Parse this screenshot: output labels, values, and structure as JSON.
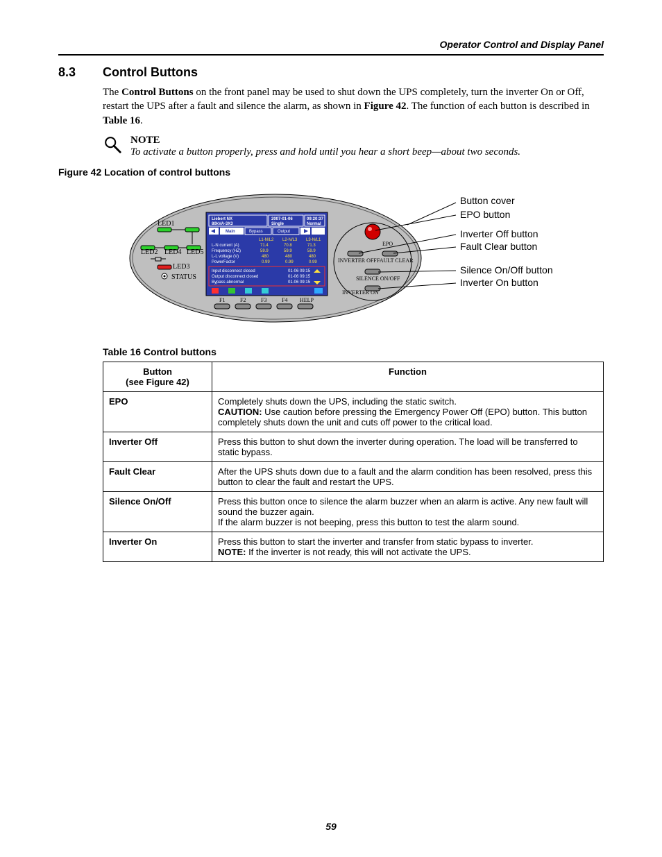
{
  "header": {
    "running": "Operator Control and Display Panel"
  },
  "section": {
    "number": "8.3",
    "title": "Control Buttons"
  },
  "para": {
    "p1a": "The ",
    "p1b": "Control Buttons",
    "p1c": " on the front panel may be used to shut down the UPS completely, turn the inverter On or Off, restart the UPS after a fault and silence the alarm, as shown in ",
    "p1d": "Figure 42",
    "p1e": ". The function of each button is described in ",
    "p1f": "Table 16",
    "p1g": "."
  },
  "note": {
    "title": "NOTE",
    "text": "To activate a button properly, press and hold until you hear a short beep—about two seconds."
  },
  "figure": {
    "caption": "Figure 42  Location of control buttons",
    "callouts": {
      "cover": "Button cover",
      "epo": "EPO button",
      "invoff": "Inverter Off button",
      "fault": "Fault Clear button",
      "silence": "Silence On/Off button",
      "invon": "Inverter On button"
    },
    "leds": {
      "l1": "LED1",
      "l2": "LED2",
      "l3": "LED3",
      "l4": "LED4",
      "l5": "LED5",
      "status": "STATUS"
    },
    "buttons": {
      "epo": "EPO",
      "invoff": "INVERTER OFF",
      "faultclear": "FAULT CLEAR",
      "silence": "SILENCE ON/OFF",
      "invon": "INVERTER ON"
    },
    "fkeys": {
      "f1": "F1",
      "f2": "F2",
      "f3": "F3",
      "f4": "F4",
      "help": "HELP"
    },
    "screen": {
      "title1": "Liebert NX",
      "title2": "80kVA-3X3",
      "date": "2007-01-06",
      "time": "09:20:37",
      "mode": "Single",
      "status": "Normal",
      "tab_main": "Main",
      "tab_bypass": "Bypass",
      "tab_output": "Output",
      "col1": "L1-N/L2",
      "col2": "L2-N/L3",
      "col3": "L3-N/L1",
      "r1": "L-N current (A)",
      "r1v": [
        "71.4",
        "70.8",
        "71.3"
      ],
      "r2": "Frequency (HZ)",
      "r2v": [
        "59.9",
        "59.9",
        "59.9"
      ],
      "r3": "L-L voltage (V)",
      "r3v": [
        "480",
        "480",
        "480"
      ],
      "r4": "PowerFactor",
      "r4v": [
        "0.99",
        "0.99",
        "0.99"
      ],
      "e1": "Input disconnect closed",
      "e1t": "01-06 09:15",
      "e2": "Output disconnect closed",
      "e2t": "01-06 09:15",
      "e3": "Bypass abnormal",
      "e3t": "01-06 09:15"
    }
  },
  "table": {
    "caption": "Table 16     Control buttons",
    "head": {
      "c1a": "Button",
      "c1b": "(see Figure 42)",
      "c2": "Function"
    },
    "rows": [
      {
        "name": "EPO",
        "func_a": "Completely shuts down the UPS, including the static switch.",
        "func_b_strong": "CAUTION:",
        "func_b_rest": " Use caution before pressing the Emergency Power Off (EPO) button. This button completely shuts down the unit and cuts off power to the critical load."
      },
      {
        "name": "Inverter Off",
        "func_a": "Press this button to shut down the inverter during operation. The load will be transferred to static bypass."
      },
      {
        "name": "Fault Clear",
        "func_a": "After the UPS shuts down due to a fault and the alarm condition has been resolved, press this button to clear the fault and restart the UPS."
      },
      {
        "name": "Silence On/Off",
        "func_a": "Press this button once to silence the alarm buzzer when an alarm is active. Any new fault will sound the buzzer again.",
        "func_c": "If the alarm buzzer is not beeping, press this button to test the alarm sound."
      },
      {
        "name": "Inverter On",
        "func_a": "Press this button to start the inverter and transfer from static bypass to inverter.",
        "func_b_strong": "NOTE:",
        "func_b_rest": " If the inverter is not ready, this will not activate the UPS."
      }
    ]
  },
  "page_number": "59"
}
